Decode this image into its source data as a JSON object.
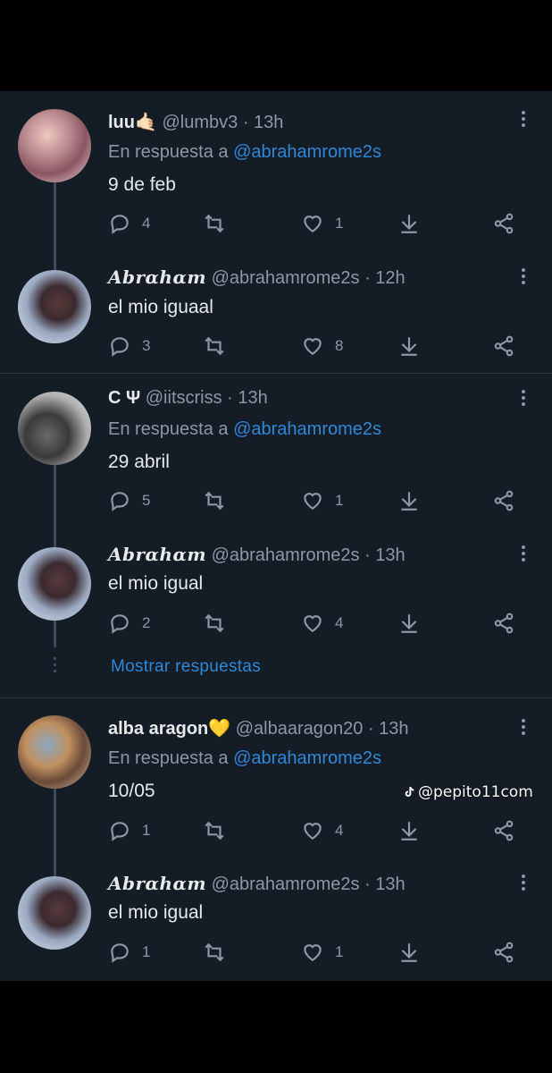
{
  "tweets": [
    {
      "name": "luu🤙🏻",
      "handle": "@lumbv3",
      "time": "· 13h",
      "reply_prefix": "En respuesta a",
      "reply_to": "@abrahamrome2s",
      "text": "9 de feb",
      "replies": "4",
      "retweets": "",
      "likes": "1"
    },
    {
      "name": "Abrαhαm",
      "handle": "@abrahamrome2s",
      "time": "· 12h",
      "text": "el mio iguaal",
      "replies": "3",
      "retweets": "",
      "likes": "8"
    },
    {
      "name": "C Ψ",
      "handle": "@iitscriss",
      "time": "· 13h",
      "reply_prefix": "En respuesta a",
      "reply_to": "@abrahamrome2s",
      "text": "29 abril",
      "replies": "5",
      "retweets": "",
      "likes": "1"
    },
    {
      "name": "Abrαhαm",
      "handle": "@abrahamrome2s",
      "time": "· 13h",
      "text": "el mio igual",
      "replies": "2",
      "retweets": "",
      "likes": "4"
    },
    {
      "name": "alba aragon💛",
      "handle": "@albaaragon20",
      "time": "· 13h",
      "reply_prefix": "En respuesta a",
      "reply_to": "@abrahamrome2s",
      "text": "10/05",
      "replies": "1",
      "retweets": "",
      "likes": "4"
    },
    {
      "name": "Abrαhαm",
      "handle": "@abrahamrome2s",
      "time": "· 13h",
      "text": "el mio igual",
      "replies": "1",
      "retweets": "",
      "likes": "1"
    }
  ],
  "show_replies_label": "Mostrar respuestas",
  "watermark": {
    "icon": "tiktok-icon",
    "text": "@pepito11com"
  },
  "colors": {
    "background": "#141c26",
    "accent": "#2f87d8",
    "muted": "#8b98a5",
    "text": "#e7e9ea"
  }
}
